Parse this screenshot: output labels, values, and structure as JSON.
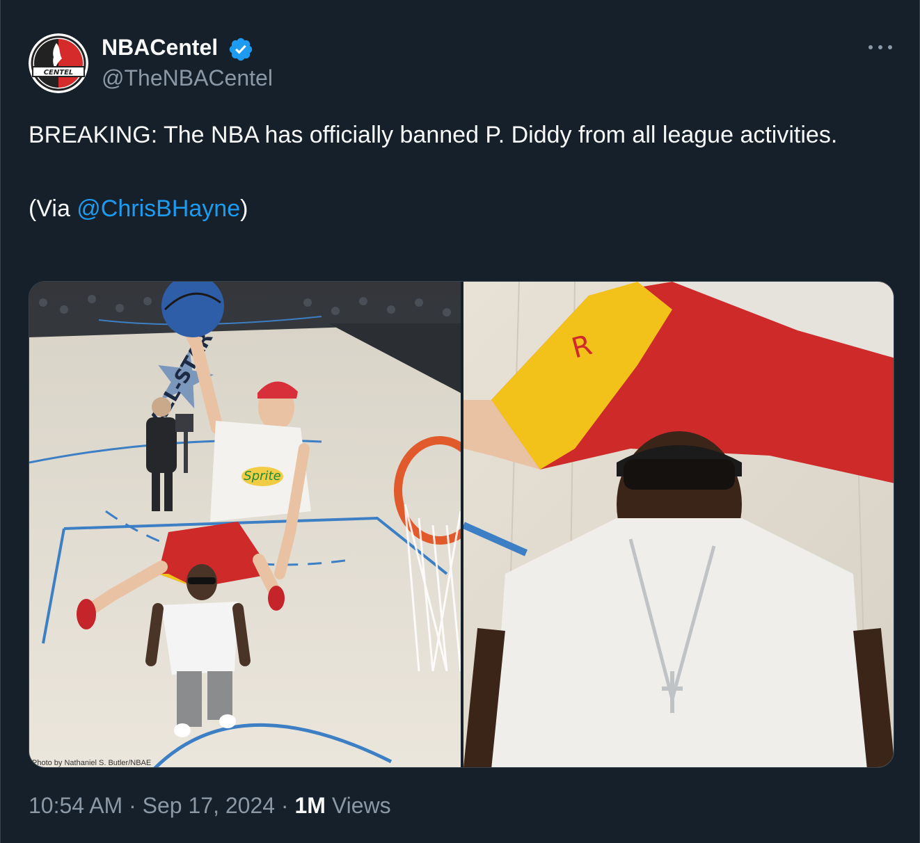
{
  "account": {
    "display_name": "NBACentel",
    "handle": "@TheNBACentel",
    "avatar_text": "CENTEL",
    "verified_icon": "verified-badge-icon"
  },
  "tweet": {
    "text_line_1": "BREAKING: The NBA has officially banned P. Diddy from all league activities.",
    "via_prefix": "(Via ",
    "via_mention": "@ChrisBHayne",
    "via_suffix": ")"
  },
  "media": {
    "left_photo_credit": "Photo by Nathaniel S. Butler/NBAE",
    "left_court_text": "ALL-STAR",
    "left_shirt_text": "Sprite"
  },
  "meta": {
    "time": "10:54 AM",
    "separator": " · ",
    "date": "Sep 17, 2024",
    "views_count": "1M",
    "views_label": " Views"
  },
  "colors": {
    "background": "#15202b",
    "text": "#f7f9f9",
    "secondary": "#8b98a5",
    "link": "#1d9bf0"
  }
}
